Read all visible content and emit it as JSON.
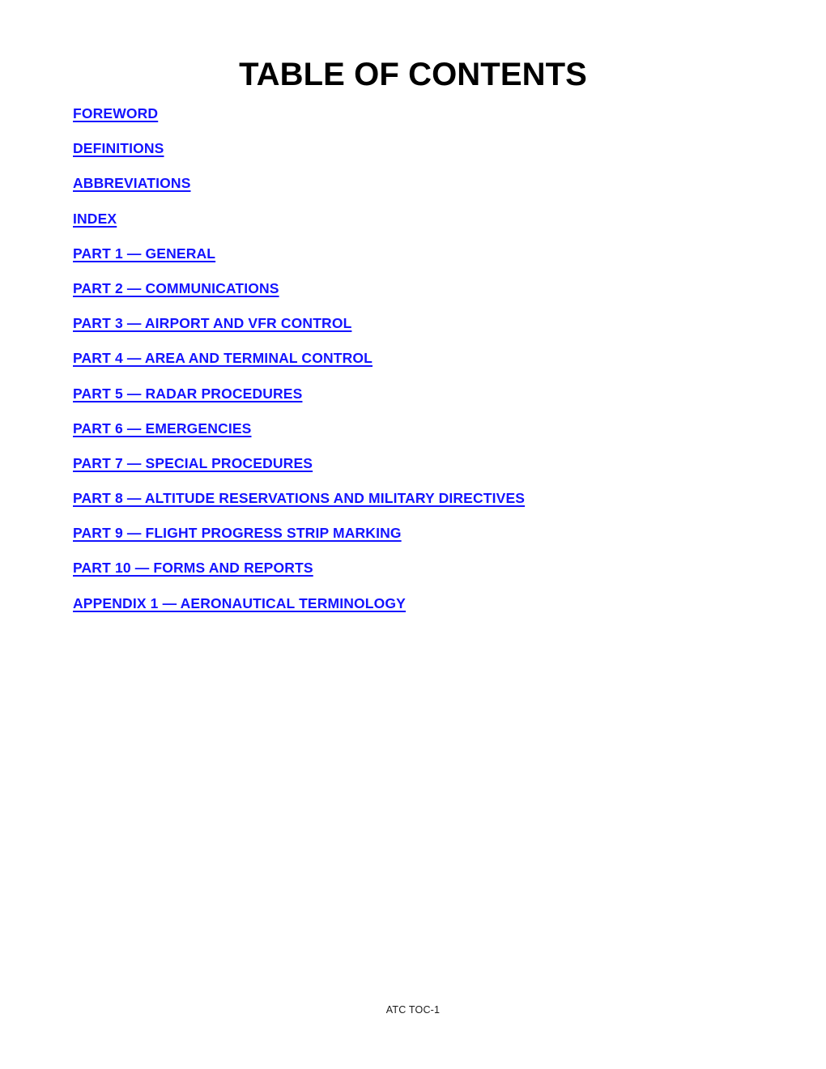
{
  "document": {
    "title": "TABLE OF CONTENTS",
    "footer": "ATC TOC-1",
    "link_color": "#1414ff",
    "title_color": "#000000",
    "background_color": "#ffffff"
  },
  "toc": {
    "entries": [
      {
        "label": "FOREWORD"
      },
      {
        "label": "DEFINITIONS"
      },
      {
        "label": "ABBREVIATIONS"
      },
      {
        "label": "INDEX"
      },
      {
        "label": "PART 1 — GENERAL"
      },
      {
        "label": "PART 2 — COMMUNICATIONS"
      },
      {
        "label": "PART 3 — AIRPORT AND VFR CONTROL"
      },
      {
        "label": "PART 4 — AREA AND TERMINAL CONTROL"
      },
      {
        "label": "PART 5 — RADAR PROCEDURES"
      },
      {
        "label": "PART 6 — EMERGENCIES"
      },
      {
        "label": "PART 7 — SPECIAL PROCEDURES"
      },
      {
        "label": "PART 8 — ALTITUDE RESERVATIONS AND MILITARY DIRECTIVES"
      },
      {
        "label": "PART 9 — FLIGHT PROGRESS STRIP MARKING"
      },
      {
        "label": "PART 10 — FORMS AND REPORTS"
      },
      {
        "label": "APPENDIX 1 — AERONAUTICAL TERMINOLOGY"
      }
    ]
  }
}
